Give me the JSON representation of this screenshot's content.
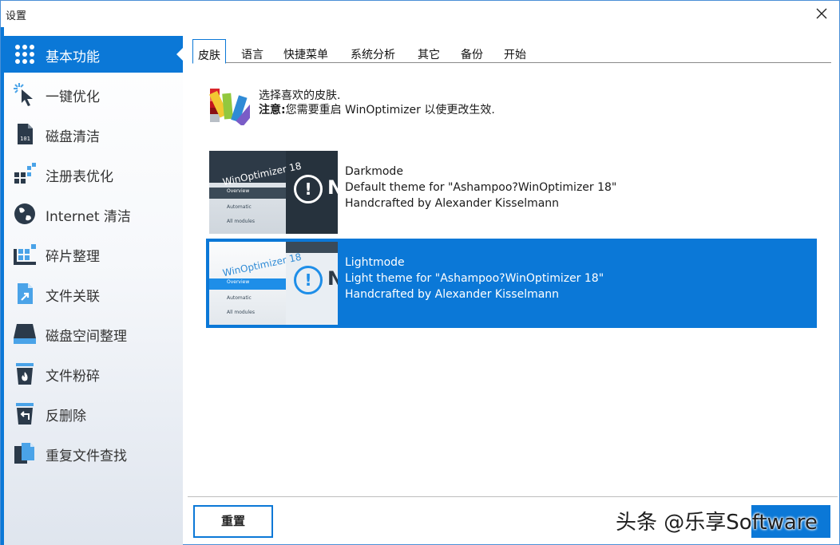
{
  "window": {
    "title": "设置"
  },
  "sidebar": {
    "items": [
      {
        "label": "基本功能",
        "icon": "grid-dots-icon",
        "active": true
      },
      {
        "label": "一键优化",
        "icon": "cursor-click-icon",
        "active": false
      },
      {
        "label": "磁盘清洁",
        "icon": "file-binary-icon",
        "active": false
      },
      {
        "label": "注册表优化",
        "icon": "registry-blocks-icon",
        "active": false
      },
      {
        "label": "Internet 清洁",
        "icon": "globe-icon",
        "active": false
      },
      {
        "label": "碎片整理",
        "icon": "defrag-blocks-icon",
        "active": false
      },
      {
        "label": "文件关联",
        "icon": "file-link-icon",
        "active": false
      },
      {
        "label": "磁盘空间整理",
        "icon": "hard-drive-icon",
        "active": false
      },
      {
        "label": "文件粉碎",
        "icon": "trash-fire-icon",
        "active": false
      },
      {
        "label": "反删除",
        "icon": "trash-undo-icon",
        "active": false
      },
      {
        "label": "重复文件查找",
        "icon": "duplicate-files-icon",
        "active": false
      }
    ]
  },
  "tabs": [
    {
      "label": "皮肤",
      "active": true
    },
    {
      "label": "语言",
      "active": false
    },
    {
      "label": "快捷菜单",
      "active": false
    },
    {
      "label": "系统分析",
      "active": false
    },
    {
      "label": "其它",
      "active": false
    },
    {
      "label": "备份",
      "active": false
    },
    {
      "label": "开始",
      "active": false
    }
  ],
  "skin": {
    "intro_line1": "选择喜欢的皮肤.",
    "intro_note_label": "注意:",
    "intro_note_text": "您需要重启 WinOptimizer 以使更改生效.",
    "themes": [
      {
        "name": "Darkmode",
        "description": "Default theme for \"Ashampoo?WinOptimizer 18\"",
        "author": "Handcrafted by Alexander Kisselmann",
        "selected": false,
        "thumb_app_name": "WinOptimizer 18",
        "thumb_menu": [
          "Overview",
          "Automatic",
          "All modules"
        ]
      },
      {
        "name": "Lightmode",
        "description": "Light theme for \"Ashampoo?WinOptimizer 18\"",
        "author": "Handcrafted by Alexander Kisselmann",
        "selected": true,
        "thumb_app_name": "WinOptimizer 18",
        "thumb_menu": [
          "Overview",
          "Automatic",
          "All modules"
        ]
      }
    ]
  },
  "footer": {
    "reset_label": "重置",
    "watermark": "头条 @乐享Software"
  },
  "colors": {
    "accent": "#0b78d7",
    "sidebar_bg": "#f4f6f9",
    "divider": "#bdbdbd"
  }
}
